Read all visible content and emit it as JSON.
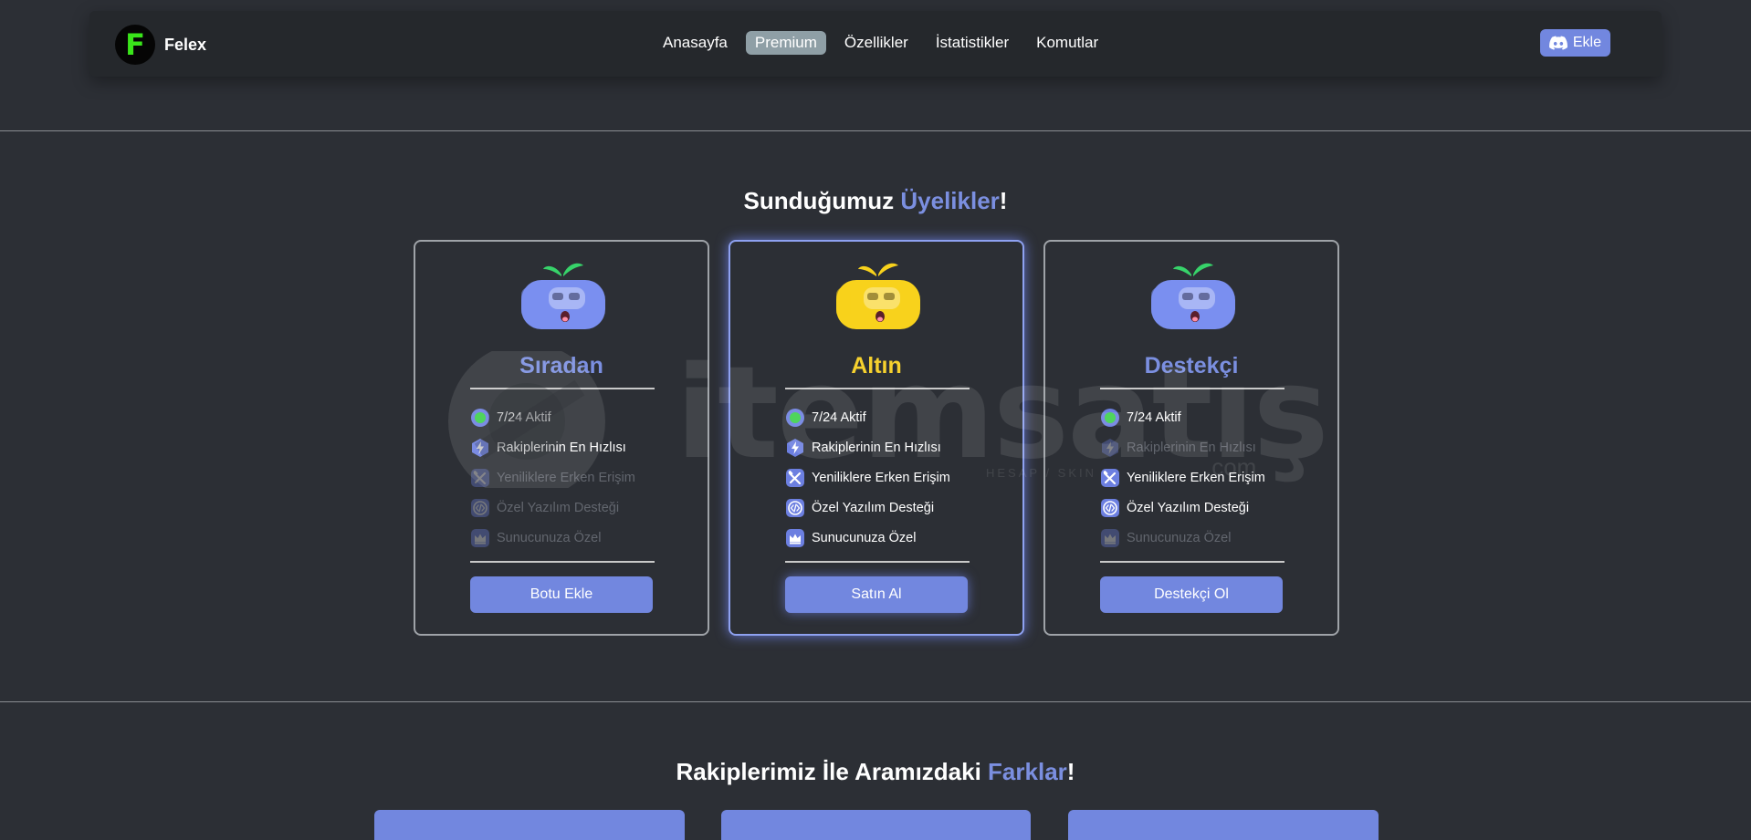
{
  "nav": {
    "brand_initial": "F",
    "brand_name": "Felex",
    "links": [
      "Anasayfa",
      "Premium",
      "Özellikler",
      "İstatistikler",
      "Komutlar"
    ],
    "active_link": "Premium",
    "add_label": "Ekle"
  },
  "memberships": {
    "title_prefix": "Sunduğumuz ",
    "title_accent": "Üyelikler",
    "title_suffix": "!",
    "plans": [
      {
        "name": "Sıradan",
        "name_color": "#7b8fe0",
        "mascot_color": "#7a8ff0",
        "leaf_color": "#37d36a",
        "features": [
          {
            "label": "7/24 Aktif",
            "icon": "online-dot-icon",
            "enabled": true
          },
          {
            "label": "Rakiplerinin En Hızlısı",
            "icon": "lightning-icon",
            "enabled": true
          },
          {
            "label": "Yeniliklere Erken Erişim",
            "icon": "tools-icon",
            "enabled": false
          },
          {
            "label": "Özel Yazılım Desteği",
            "icon": "code-icon",
            "enabled": false
          },
          {
            "label": "Sunucunuza Özel",
            "icon": "crown-icon",
            "enabled": false
          }
        ],
        "cta": "Botu Ekle"
      },
      {
        "name": "Altın",
        "name_color": "#f6d12e",
        "mascot_color": "#f8d21c",
        "leaf_color": "#f8d21c",
        "features": [
          {
            "label": "7/24 Aktif",
            "icon": "online-dot-icon",
            "enabled": true
          },
          {
            "label": "Rakiplerinin En Hızlısı",
            "icon": "lightning-icon",
            "enabled": true
          },
          {
            "label": "Yeniliklere Erken Erişim",
            "icon": "tools-icon",
            "enabled": true
          },
          {
            "label": "Özel Yazılım Desteği",
            "icon": "code-icon",
            "enabled": true
          },
          {
            "label": "Sunucunuza Özel",
            "icon": "crown-icon",
            "enabled": true
          }
        ],
        "cta": "Satın Al"
      },
      {
        "name": "Destekçi",
        "name_color": "#7b8fe0",
        "mascot_color": "#7a8ff0",
        "leaf_color": "#37d36a",
        "features": [
          {
            "label": "7/24 Aktif",
            "icon": "online-dot-icon",
            "enabled": true
          },
          {
            "label": "Rakiplerinin En Hızlısı",
            "icon": "lightning-icon",
            "enabled": false
          },
          {
            "label": "Yeniliklere Erken Erişim",
            "icon": "tools-icon",
            "enabled": true
          },
          {
            "label": "Özel Yazılım Desteği",
            "icon": "code-icon",
            "enabled": true
          },
          {
            "label": "Sunucunuza Özel",
            "icon": "crown-icon",
            "enabled": false
          }
        ],
        "cta": "Destekçi Ol"
      }
    ]
  },
  "comparison": {
    "title_prefix": "Rakiplerimiz İle Aramızdaki ",
    "title_accent": "Farklar",
    "title_suffix": "!"
  },
  "watermark": {
    "brand": "itemsatış",
    "domain": ".com",
    "tagline": "HESAP / SKIN"
  },
  "colors": {
    "background": "#2c2f35",
    "navbar": "#25282c",
    "accent": "#7287df",
    "gold": "#f6d12e",
    "online": "#3bd14a"
  }
}
